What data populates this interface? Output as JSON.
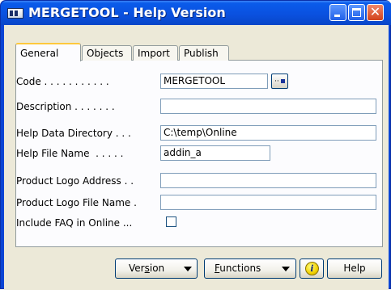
{
  "window": {
    "title": "MERGETOOL - Help Version"
  },
  "tabs": [
    "General",
    "Objects",
    "Import",
    "Publish"
  ],
  "fields": {
    "code": {
      "label": "Code . . . . . . . . . . .",
      "value": "MERGETOOL"
    },
    "description": {
      "label": "Description . . . . . . .",
      "value": ""
    },
    "help_data_directory": {
      "label": "Help Data Directory . . .",
      "value": "C:\\temp\\Online"
    },
    "help_file_name": {
      "label": "Help File Name  . . . . .",
      "value": "addin_a"
    },
    "product_logo_address": {
      "label": "Product Logo Address . .",
      "value": ""
    },
    "product_logo_file_name": {
      "label": "Product Logo File Name .",
      "value": ""
    },
    "include_faq": {
      "label": "Include FAQ in Online ...",
      "checked": false
    }
  },
  "buttons": {
    "version": {
      "pre": "Ver",
      "accel": "s",
      "post": "ion"
    },
    "functions": {
      "pre": "",
      "accel": "F",
      "post": "unctions"
    },
    "help": "Help"
  },
  "icons": {
    "app": "window-app-icon",
    "lookup": "lookup-icon",
    "info": "info-icon",
    "dropdown": "chevron-down-icon"
  }
}
